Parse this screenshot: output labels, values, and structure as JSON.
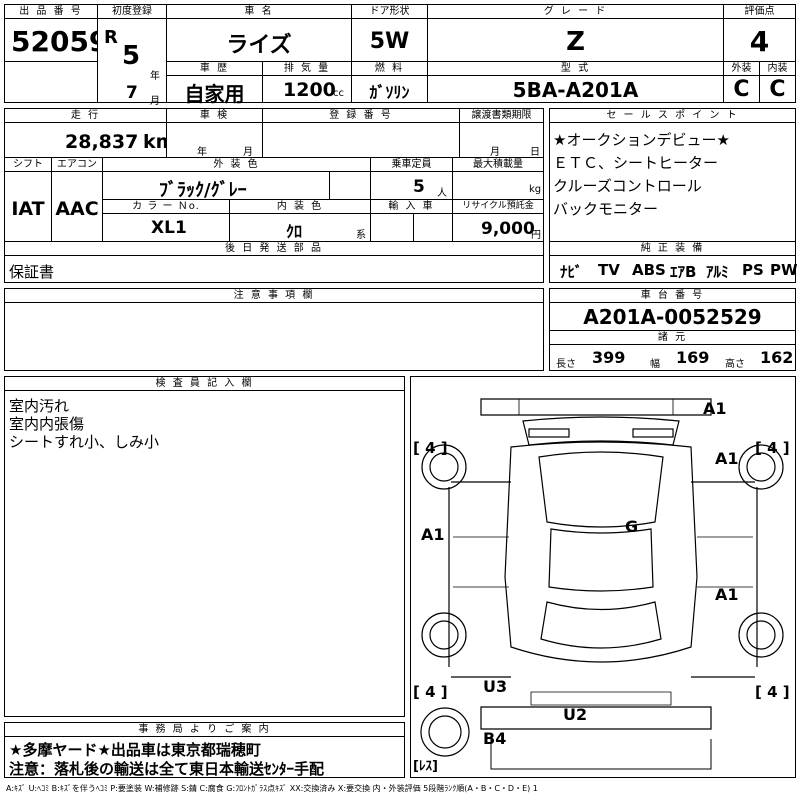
{
  "header": {
    "lot_label": "出 品 番 号",
    "lot_no": "52059",
    "first_reg_label": "初度登録",
    "era": "R",
    "year": "5",
    "year_unit": "年",
    "month": "7",
    "month_unit": "月",
    "name_label": "車 名",
    "name": "ライズ",
    "door_label": "ドア形状",
    "door": "5W",
    "grade_label": "グ レ ー ド",
    "grade": "Z",
    "score_label": "評価点",
    "score": "4",
    "history_label": "車 歴",
    "history": "自家用",
    "disp_label": "排 気 量",
    "disp": "1200",
    "disp_unit": "cc",
    "fuel_label": "燃 料",
    "fuel": "ｶﾞｿﾘﾝ",
    "model_label": "型 式",
    "model": "5BA-A201A",
    "ext_label": "外装",
    "ext": "C",
    "int_label": "内装",
    "int": "C"
  },
  "row2": {
    "mileage_label": "走 行",
    "mileage": "28,837",
    "mileage_unit": "km",
    "inspection_label": "車 検",
    "ins_year": "年",
    "ins_month": "月",
    "regno_label": "登 録 番 号",
    "transfer_label": "譲渡書類期限",
    "tr_month": "月",
    "tr_day": "日",
    "shift_label": "シフト",
    "shift": "IAT",
    "ac_label": "エアコン",
    "ac": "AAC",
    "color_label": "外 装 色",
    "color": "ﾌﾞﾗｯｸ/ｸﾞﾚｰ",
    "capacity_label": "乗車定員",
    "capacity": "5",
    "capacity_unit": "人",
    "load_label": "最大積載量",
    "load_unit": "kg",
    "colorno_label": "カ ラ ー Ｎo.",
    "colorno": "XL1",
    "intcolor_label": "内 装 色",
    "intcolor": "ｸﾛ",
    "intcolor_unit": "系",
    "import_label": "輸 入 車",
    "recycle_label": "リサイクル預託金",
    "recycle": "9,000",
    "recycle_unit": "円"
  },
  "sales": {
    "label": "セ ー ル ス ポ イ ン ト",
    "lines": [
      "★オークションデビュー★",
      "ＥＴＣ、シートヒーター",
      "クルーズコントロール",
      "バックモニター"
    ]
  },
  "later": {
    "label": "後 日 発 送 部 品",
    "text": "保証書"
  },
  "equipment": {
    "label": "純 正 装 備",
    "items": [
      "ﾅﾋﾞ",
      "TV",
      "ABS",
      "ｴｱB",
      "ｱﾙﾐ",
      "PS",
      "PW"
    ]
  },
  "notes": {
    "label": "注 意 事 項 欄"
  },
  "chassis": {
    "label": "車 台 番 号",
    "no": "A201A-0052529"
  },
  "dims": {
    "label": "諸 元",
    "len_label": "長さ",
    "len": "399",
    "wid_label": "幅",
    "wid": "169",
    "hgt_label": "高さ",
    "hgt": "162"
  },
  "inspector": {
    "label": "検 査 員 記 入 欄",
    "lines": [
      "室内汚れ",
      "室内内張傷",
      "シートすれ小、しみ小"
    ]
  },
  "office": {
    "label": "事 務 局 よ り ご 案 内",
    "lines": [
      "★多摩ヤード★出品車は東京都瑞穂町",
      "注意：落札後の輸送は全て東日本輸送ｾﾝﾀｰ手配"
    ]
  },
  "diagram": {
    "tire_fl": "[ 4 ]",
    "tire_fr": "[ 4 ]",
    "tire_rl": "[ 4 ]",
    "tire_rr": "[ 4 ]",
    "spare": "[ﾚｽ]",
    "marks": [
      "A1",
      "A1",
      "A1",
      "G",
      "A1",
      "U3",
      "U2",
      "B4"
    ]
  },
  "legend": "A:ｷｽﾞ U:ﾍｺﾐ B:ｷｽﾞを伴うﾍｺﾐ P:要塗装 W:補修跡 S:錆 C:腐食 G:ﾌﾛﾝﾄｶﾞﾗｽ点ｷｽﾞ XX:交換済み X:要交換 内・外装評価 5段階ﾗﾝｸ順(A・B・C・D・E) 1"
}
